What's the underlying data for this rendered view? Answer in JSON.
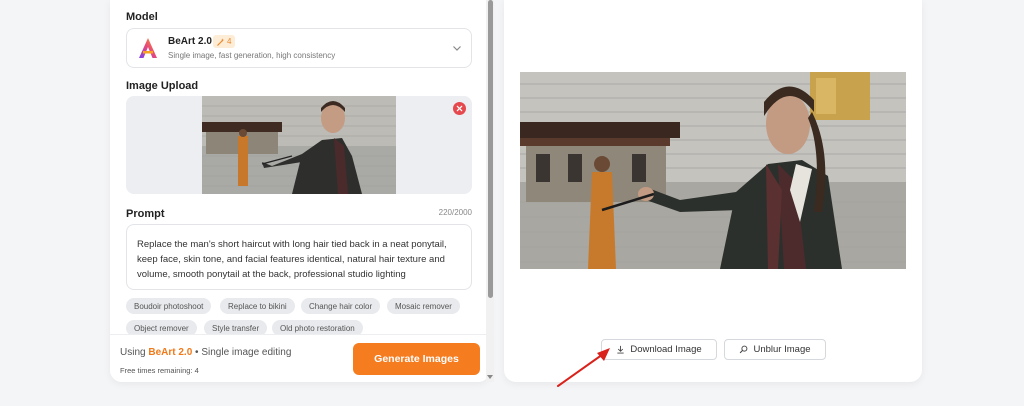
{
  "model": {
    "section_label": "Model",
    "name": "BeArt 2.0",
    "badge_count": "4",
    "description": "Single image, fast generation, high consistency"
  },
  "upload": {
    "section_label": "Image Upload"
  },
  "prompt": {
    "section_label": "Prompt",
    "count": "220/2000",
    "lines": [
      "Replace the man's short haircut with long hair tied back in a neat ponytail,",
      "keep face, skin tone, and facial features identical, natural hair texture and",
      "volume, smooth ponytail at the back, professional studio lighting"
    ]
  },
  "chips": [
    "Boudoir photoshoot",
    "Replace to bikini",
    "Change hair color",
    "Mosaic remover",
    "Object remover",
    "Style transfer",
    "Old photo restoration"
  ],
  "footer": {
    "using_prefix": "Using",
    "using_model": "BeArt 2.0",
    "using_suffix": "• Single image editing",
    "free_times": "Free times remaining: 4",
    "generate_label": "Generate Images"
  },
  "result": {
    "download_label": "Download Image",
    "unblur_label": "Unblur Image"
  },
  "colors": {
    "accent": "#f57c1f",
    "remove": "#e5484d",
    "annotation_arrow": "#d9221c"
  }
}
